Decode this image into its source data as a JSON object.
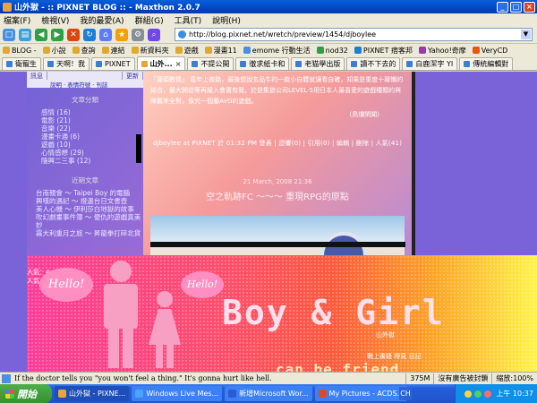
{
  "window": {
    "title": "山外獄 - :: PIXNET BLOG :: - Maxthon 2.0.7",
    "min": "_",
    "max": "□",
    "close": "×"
  },
  "menu": [
    "檔案(F)",
    "檢視(V)",
    "我的最愛(A)",
    "群組(G)",
    "工具(T)",
    "說明(H)"
  ],
  "address": {
    "url": "http://blog.pixnet.net/wretch/preview/1454/djboylee"
  },
  "favorites": [
    "BLOG -",
    "小說",
    "查詢",
    "連結",
    "新資料夾",
    "遊戲",
    "漫畫11",
    "emome 行動生活",
    "nod32",
    "PIXNET 痞客邦",
    "Yahoo!奇摩",
    "VeryCD"
  ],
  "tabs": [
    {
      "label": "衛寵生",
      "active": false
    },
    {
      "label": "天啊！我",
      "active": false
    },
    {
      "label": "PIXNET",
      "active": false
    },
    {
      "label": "山外...",
      "active": true
    },
    {
      "label": "不提公開",
      "active": false
    },
    {
      "label": "徹求紙卡和",
      "active": false
    },
    {
      "label": "老猫學出版",
      "active": false
    },
    {
      "label": "讀不下去的",
      "active": false
    },
    {
      "label": "白鹿潔字 YI",
      "active": false
    },
    {
      "label": "傳統編輯對",
      "active": false
    }
  ],
  "sidebar": {
    "tabs": [
      "訊息",
      "",
      "更新"
    ],
    "links": "說明 · 表情符號 · 刊誌",
    "section_categories": "文章分類",
    "categories": [
      "感情 (16)",
      "電影 (21)",
      "音樂 (22)",
      "漫畫卡通 (6)",
      "遊戲 (10)",
      "心情感想 (29)",
      "隨興二三事 (12)"
    ],
    "section_articles": "近期文章",
    "articles": [
      "台南親會 ～ Taipei Boy 的電腦",
      "興嘆的遇記 ～ 燈邊台日文書壺",
      "美人心機 ～ 伊利莎白地獄的故事",
      "吹幻劇畫事件簿 ～ 便仇的遊戲真美妙",
      "霧大利重月之旅 ～ 昇龍拳打碎北貨"
    ]
  },
  "post": {
    "text": "「蕭碩數情」 嘉年上夜路，最後想說玄品牛的一款小自體就讓看自確，知果是重度十躍懶的結合，最大開從等再緩入會置有我，於是集旅公司LEVEL·5用日本人最喜愛的遊戲種類的與陣舊來全對，像究一個屬AVG的遊戲。",
    "sign": "(鳥爛閑聞)",
    "meta": "djboylee at PIXNET 於 01:32 PM 發表 | 迴響(0) | 引用(0) | 編輯 | 刪除 | 人氣(41)",
    "date": "21 March, 2008 21:36",
    "title": "空之軌跡FC ～～～ 重現RPG的原點"
  },
  "banner": {
    "left_text1": "人氣：4",
    "left_text2": "人氣：",
    "bubble1": "Hello!",
    "bubble2": "Hello!",
    "headline": "Boy & Girl",
    "sub1": "山外獄",
    "sub2": "戰上書籍 得見 日記",
    "tagline": "can be friend."
  },
  "status": {
    "text": "If the doctor tells you \"you won't feel a thing.\" It's gonna hurt like hell.",
    "size": "375M",
    "popup": "沒有廣告被封鎖",
    "zoom": "縮放:100%"
  },
  "taskbar": {
    "start": "開始",
    "tasks": [
      {
        "label": "山外獄 - PIXNE...",
        "active": true,
        "color": "#e9a43a"
      },
      {
        "label": "Windows Live Mes...",
        "active": false,
        "color": "#4aa3ff"
      },
      {
        "label": "新增Microsoft Wor...",
        "active": false,
        "color": "#2b5ad8"
      },
      {
        "label": "My Pictures - ACDS...",
        "active": false,
        "color": "#d94a2a"
      }
    ],
    "lang": "CH",
    "clock": "上午 10:37"
  }
}
